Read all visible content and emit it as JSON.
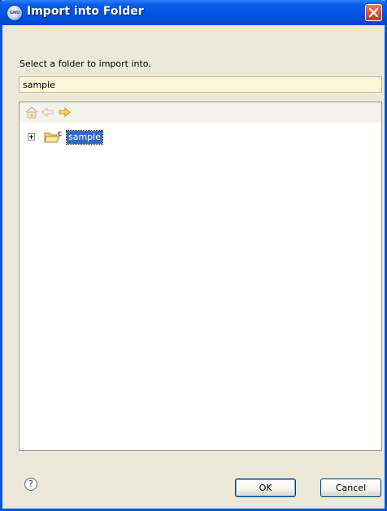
{
  "window": {
    "title": "Import into Folder",
    "app_icon": "eclipse-gnu-icon",
    "app_icon_text": "GNU"
  },
  "dialog": {
    "instruction": "Select a folder to import into.",
    "path_value": "sample"
  },
  "tree": {
    "toolbar_icons": [
      "home-icon",
      "back-arrow-icon",
      "forward-arrow-icon"
    ],
    "nodes": [
      {
        "label": "sample",
        "icon": "open-folder-c-icon",
        "expanded": false,
        "selected": true
      }
    ]
  },
  "buttons": {
    "help_icon": "help-icon",
    "help_glyph": "?",
    "ok_label": "OK",
    "cancel_label": "Cancel"
  },
  "colors": {
    "titlebar": "#0054e3",
    "selection": "#316ac5",
    "field_background": "#fdf6d9",
    "dialog_background": "#ece9d8"
  }
}
